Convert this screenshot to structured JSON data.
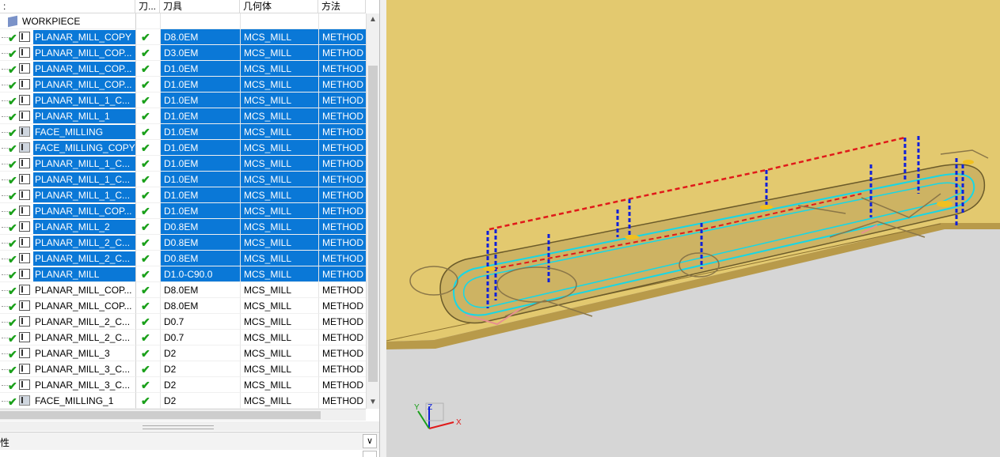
{
  "navigator": {
    "columns": {
      "name": "",
      "check": "刀...",
      "tool": "刀具",
      "geometry": "几何体",
      "method": "方法"
    },
    "workpiece": "WORKPIECE",
    "operations": [
      {
        "name": "PLANAR_MILL_COPY",
        "tool": "D8.0EM",
        "geometry": "MCS_MILL",
        "method": "METHOD",
        "selected": true,
        "icon": "planar-mill-icon"
      },
      {
        "name": "PLANAR_MILL_COP...",
        "tool": "D3.0EM",
        "geometry": "MCS_MILL",
        "method": "METHOD",
        "selected": true,
        "icon": "planar-mill-icon"
      },
      {
        "name": "PLANAR_MILL_COP...",
        "tool": "D1.0EM",
        "geometry": "MCS_MILL",
        "method": "METHOD",
        "selected": true,
        "icon": "planar-mill-icon"
      },
      {
        "name": "PLANAR_MILL_COP...",
        "tool": "D1.0EM",
        "geometry": "MCS_MILL",
        "method": "METHOD",
        "selected": true,
        "icon": "planar-mill-icon"
      },
      {
        "name": "PLANAR_MILL_1_C...",
        "tool": "D1.0EM",
        "geometry": "MCS_MILL",
        "method": "METHOD",
        "selected": true,
        "icon": "planar-mill-icon"
      },
      {
        "name": "PLANAR_MILL_1",
        "tool": "D1.0EM",
        "geometry": "MCS_MILL",
        "method": "METHOD",
        "selected": true,
        "icon": "planar-mill-icon"
      },
      {
        "name": "FACE_MILLING",
        "tool": "D1.0EM",
        "geometry": "MCS_MILL",
        "method": "METHOD",
        "selected": true,
        "icon": "face-milling-icon"
      },
      {
        "name": "FACE_MILLING_COPY",
        "tool": "D1.0EM",
        "geometry": "MCS_MILL",
        "method": "METHOD",
        "selected": true,
        "icon": "face-milling-icon"
      },
      {
        "name": "PLANAR_MILL_1_C...",
        "tool": "D1.0EM",
        "geometry": "MCS_MILL",
        "method": "METHOD",
        "selected": true,
        "icon": "planar-mill-icon"
      },
      {
        "name": "PLANAR_MILL_1_C...",
        "tool": "D1.0EM",
        "geometry": "MCS_MILL",
        "method": "METHOD",
        "selected": true,
        "icon": "planar-mill-icon"
      },
      {
        "name": "PLANAR_MILL_1_C...",
        "tool": "D1.0EM",
        "geometry": "MCS_MILL",
        "method": "METHOD",
        "selected": true,
        "icon": "planar-mill-icon"
      },
      {
        "name": "PLANAR_MILL_COP...",
        "tool": "D1.0EM",
        "geometry": "MCS_MILL",
        "method": "METHOD",
        "selected": true,
        "icon": "planar-mill-icon"
      },
      {
        "name": "PLANAR_MILL_2",
        "tool": "D0.8EM",
        "geometry": "MCS_MILL",
        "method": "METHOD",
        "selected": true,
        "icon": "planar-mill-icon"
      },
      {
        "name": "PLANAR_MILL_2_C...",
        "tool": "D0.8EM",
        "geometry": "MCS_MILL",
        "method": "METHOD",
        "selected": true,
        "icon": "planar-mill-icon"
      },
      {
        "name": "PLANAR_MILL_2_C...",
        "tool": "D0.8EM",
        "geometry": "MCS_MILL",
        "method": "METHOD",
        "selected": true,
        "icon": "planar-mill-icon"
      },
      {
        "name": "PLANAR_MILL",
        "tool": "D1.0-C90.0",
        "geometry": "MCS_MILL",
        "method": "METHOD",
        "selected": true,
        "icon": "planar-mill-icon"
      },
      {
        "name": "PLANAR_MILL_COP...",
        "tool": "D8.0EM",
        "geometry": "MCS_MILL",
        "method": "METHOD",
        "selected": false,
        "icon": "planar-mill-icon"
      },
      {
        "name": "PLANAR_MILL_COP...",
        "tool": "D8.0EM",
        "geometry": "MCS_MILL",
        "method": "METHOD",
        "selected": false,
        "icon": "planar-mill-icon"
      },
      {
        "name": "PLANAR_MILL_2_C...",
        "tool": "D0.7",
        "geometry": "MCS_MILL",
        "method": "METHOD",
        "selected": false,
        "icon": "planar-mill-icon"
      },
      {
        "name": "PLANAR_MILL_2_C...",
        "tool": "D0.7",
        "geometry": "MCS_MILL",
        "method": "METHOD",
        "selected": false,
        "icon": "planar-mill-icon"
      },
      {
        "name": "PLANAR_MILL_3",
        "tool": "D2",
        "geometry": "MCS_MILL",
        "method": "METHOD",
        "selected": false,
        "icon": "planar-mill-icon"
      },
      {
        "name": "PLANAR_MILL_3_C...",
        "tool": "D2",
        "geometry": "MCS_MILL",
        "method": "METHOD",
        "selected": false,
        "icon": "planar-mill-icon"
      },
      {
        "name": "PLANAR_MILL_3_C...",
        "tool": "D2",
        "geometry": "MCS_MILL",
        "method": "METHOD",
        "selected": false,
        "icon": "planar-mill-icon"
      },
      {
        "name": "FACE_MILLING_1",
        "tool": "D2",
        "geometry": "MCS_MILL",
        "method": "METHOD",
        "selected": false,
        "icon": "face-milling-icon"
      }
    ],
    "status_glyph": "✔",
    "properties_label": "性"
  },
  "triad": {
    "x": "X",
    "y": "Y",
    "z": "Z"
  },
  "colors": {
    "selection": "#0a78d7",
    "part_top": "#e3c96f",
    "part_side": "#b89a4a",
    "background": "#d6d6d6",
    "toolpath_feed": "#16d7e6",
    "toolpath_rapid": "#e01a1a",
    "toolpath_plunge": "#1020d8"
  }
}
